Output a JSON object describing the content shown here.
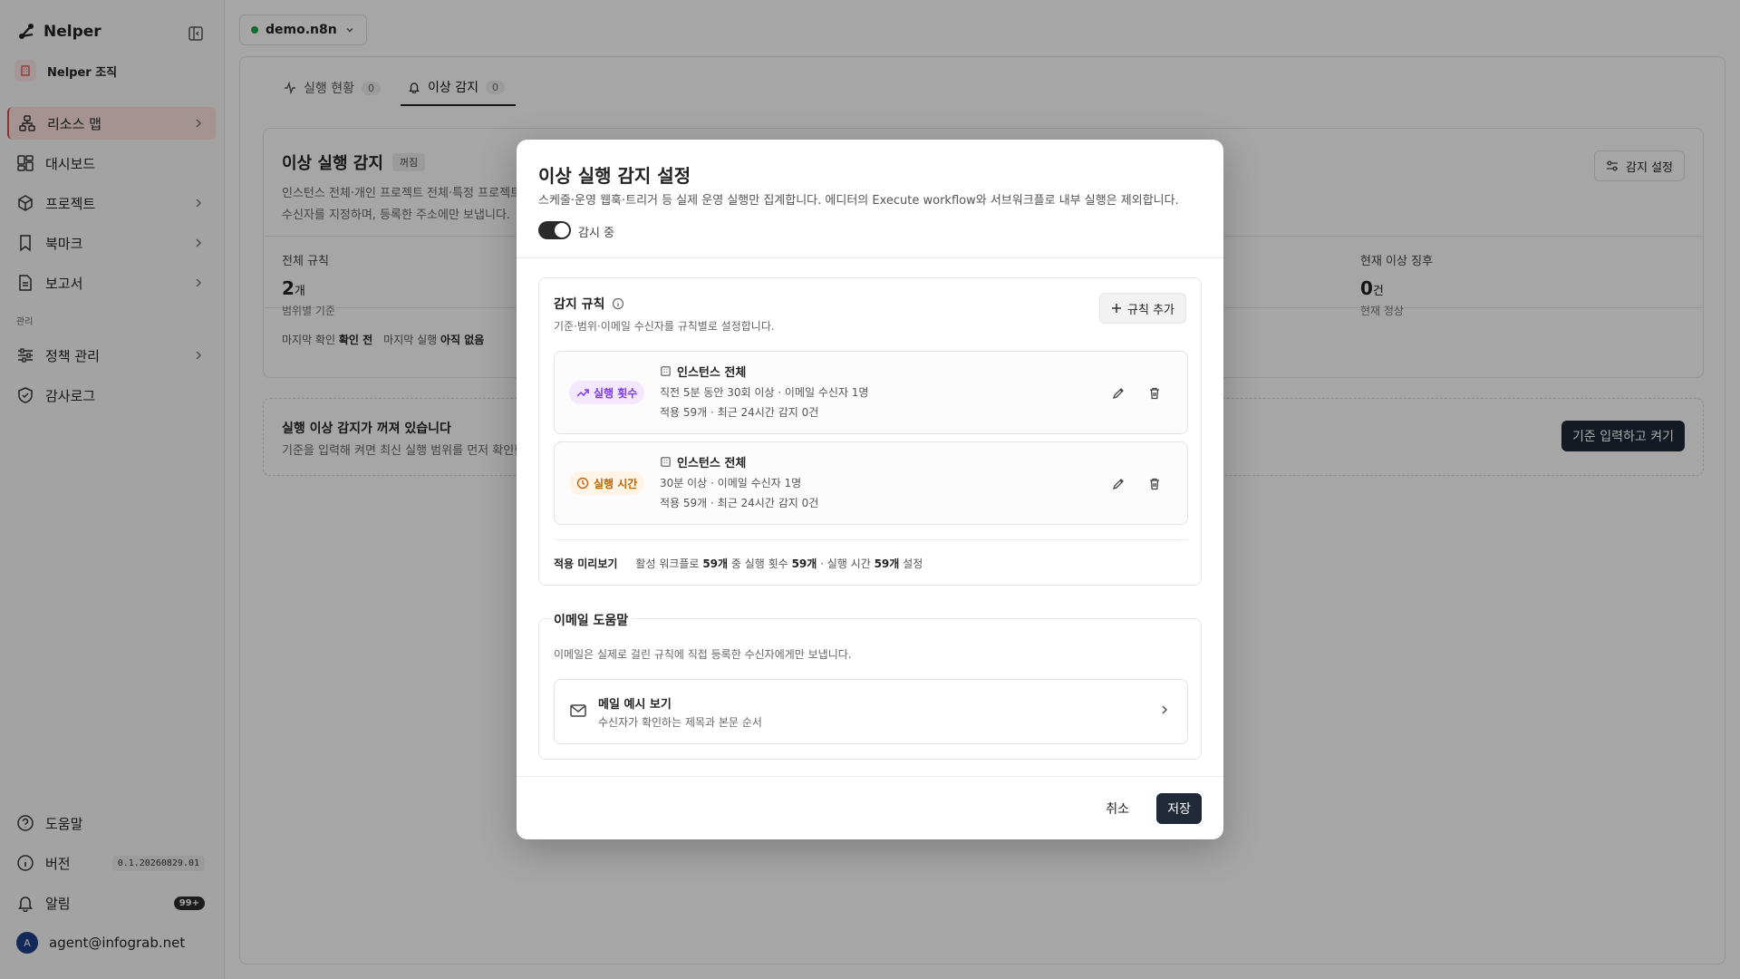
{
  "app": {
    "name": "Nelper",
    "org": "Nelper 조직"
  },
  "sidebar": {
    "items": [
      {
        "label": "리소스 맵",
        "icon": "sitemap-icon",
        "chevron": true,
        "active": true
      },
      {
        "label": "대시보드",
        "icon": "dashboard-icon",
        "chevron": false
      },
      {
        "label": "프로젝트",
        "icon": "box-icon",
        "chevron": true
      },
      {
        "label": "북마크",
        "icon": "bookmark-icon",
        "chevron": true
      },
      {
        "label": "보고서",
        "icon": "report-icon",
        "chevron": true
      }
    ],
    "section_label": "관리",
    "admin_items": [
      {
        "label": "정책 관리",
        "icon": "sliders-icon",
        "chevron": true
      },
      {
        "label": "감사로그",
        "icon": "shield-icon",
        "chevron": false
      }
    ],
    "bottom": {
      "help": "도움말",
      "version_label": "버전",
      "version": "0.1.20260829.01",
      "alerts_label": "알림",
      "alerts_count": "99+",
      "user_initial": "A",
      "user_email": "agent@infograb.net"
    }
  },
  "instance": {
    "name": "demo.n8n",
    "status_color": "#22a34a"
  },
  "tabs": [
    {
      "label": "실행 현황",
      "count": "0",
      "active": false
    },
    {
      "label": "이상 감지",
      "count": "0",
      "active": true
    }
  ],
  "detect_card": {
    "title": "이상 실행 감지",
    "badge": "꺼짐",
    "desc_line1": "인스턴스 전체·개인 프로젝트 전체·특정 프로젝트",
    "desc_line2": "수신자를 지정하며, 등록한 주소에만 보냅니다.",
    "settings_button": "감지 설정",
    "stat_rules": {
      "label": "전체 규칙",
      "value": "2",
      "unit": "개",
      "sub": "범위별 기준"
    },
    "stat_current": {
      "label": "현재 이상 징후",
      "value": "0",
      "unit": "건",
      "sub": "현재 정상"
    },
    "last_check_label": "마지막 확인",
    "last_check_value": "확인 전",
    "last_exec_label": "마지막 실행",
    "last_exec_value": "아직 없음"
  },
  "off_card": {
    "title": "실행 이상 감지가 꺼져 있습니다",
    "desc": "기준을 입력해 켜면 최신 실행 범위를 먼저 확인한 뒤",
    "button": "기준 입력하고 켜기"
  },
  "modal": {
    "title": "이상 실행 감지 설정",
    "desc": "스케줄·운영 웹훅·트리거 등 실제 운영 실행만 집계합니다. 에디터의 Execute workflow와 서브워크플로 내부 실행은 제외합니다.",
    "toggle_label": "감시 중",
    "rules_title": "감지 규칙",
    "rules_desc": "기준·범위·이메일 수신자를 규칙별로 설정합니다.",
    "add_rule": "규칙 추가",
    "rules": [
      {
        "tag": "실행 횟수",
        "tag_color": "#7c3aed",
        "scope": "인스턴스 전체",
        "line1": "직전 5분 동안 30회 이상 · 이메일 수신자 1명",
        "line2": "적용 59개 · 최근 24시간 감지 0건"
      },
      {
        "tag": "실행 시간",
        "tag_color": "#c2620a",
        "scope": "인스턴스 전체",
        "line1": "30분 이상 · 이메일 수신자 1명",
        "line2": "적용 59개 · 최근 24시간 감지 0건"
      }
    ],
    "preview": {
      "label": "적용 미리보기",
      "t1": "활성 워크플로",
      "n1": "59개",
      "t2": "중 실행 횟수",
      "n2": "59개",
      "t3": "· 실행 시간",
      "n3": "59개",
      "t4": "설정"
    },
    "email": {
      "legend": "이메일 도움말",
      "desc": "이메일은 실제로 걸린 규칙에 직접 등록한 수신자에게만 보냅니다.",
      "sample_title": "메일 예시 보기",
      "sample_sub": "수신자가 확인하는 제목과 본문 순서"
    },
    "cancel": "취소",
    "save": "저장"
  }
}
